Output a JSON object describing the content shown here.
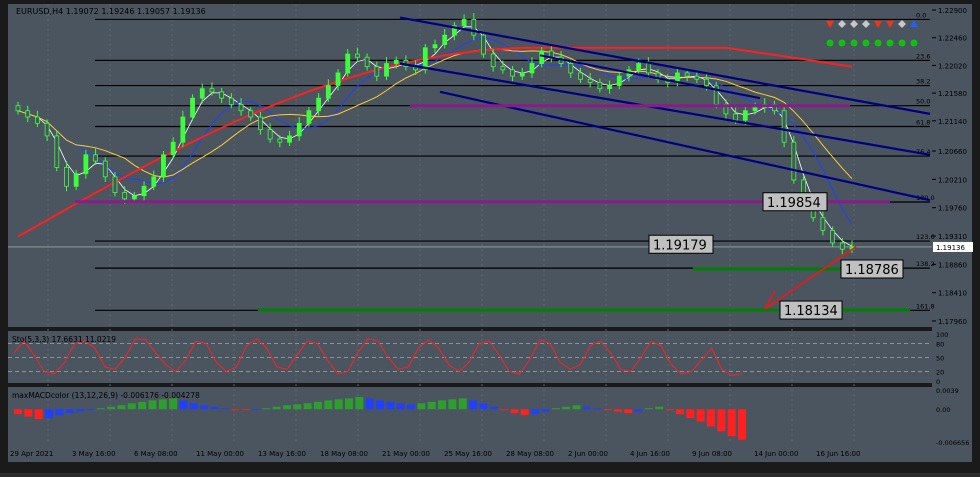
{
  "chart_data": {
    "type": "candlestick",
    "symbol_header": "EURUSD,H4  1.19072 1.19246 1.19057 1.19136",
    "colors": {
      "background": "#4a5560",
      "bull": "#3cff3c",
      "bear": "#3cff3c",
      "fib_lines": "#000000",
      "channel": "#000080",
      "sma_fast": "#ffffff",
      "sma_mid": "#2040ff",
      "sma_slow": "#ffcc33",
      "sma_long": "#ff2020",
      "support_purple": "#8b1a8b",
      "target_green": "#008000",
      "macd_pos": "#2e9e2e",
      "macd_neg": "#ff2020",
      "macd_blue": "#2040ff",
      "stoch": "#ff2020"
    },
    "price_axis": {
      "range": [
        1.1796,
        1.229
      ],
      "ticks": [
        "1.22900",
        "1.22460",
        "1.22020",
        "1.21580",
        "1.21140",
        "1.20660",
        "1.20210",
        "1.19760",
        "1.19310",
        "1.18860",
        "1.18410",
        "1.17960"
      ],
      "tick_values": [
        1.229,
        1.2246,
        1.2202,
        1.2158,
        1.2114,
        1.2066,
        1.2021,
        1.1976,
        1.1931,
        1.1886,
        1.1841,
        1.1796
      ],
      "current_price": "1.19136",
      "current_value": 1.19136
    },
    "time_axis": {
      "labels": [
        "29 Apr 2021",
        "3 May 16:00",
        "6 May 08:00",
        "11 May 00:00",
        "13 May 16:00",
        "18 May 08:00",
        "21 May 00:00",
        "25 May 16:00",
        "28 May 08:00",
        "2 Jun 00:00",
        "4 Jun 16:00",
        "9 Jun 08:00",
        "14 Jun 00:00",
        "16 Jun 16:00"
      ]
    },
    "fib_levels": [
      {
        "label": "0.0",
        "price": 1.2275
      },
      {
        "label": "23.6",
        "price": 1.221
      },
      {
        "label": "38.2",
        "price": 1.217
      },
      {
        "label": "50.0",
        "price": 1.2138
      },
      {
        "label": "61.8",
        "price": 1.2105
      },
      {
        "label": "76.4",
        "price": 1.2058
      },
      {
        "label": "100.0",
        "price": 1.1985
      },
      {
        "label": "123.6",
        "price": 1.1923
      },
      {
        "label": "138.2",
        "price": 1.188
      },
      {
        "label": "161.8",
        "price": 1.1813
      }
    ],
    "annotations": [
      {
        "text": "1.19854",
        "price": 1.19854
      },
      {
        "text": "1.19179",
        "price": 1.19179
      },
      {
        "text": "1.18786",
        "price": 1.18786
      },
      {
        "text": "1.18134",
        "price": 1.18134
      }
    ],
    "signal_row_1": [
      "down",
      "diamond",
      "diamond",
      "diamond",
      "down",
      "down",
      "diamond",
      "up"
    ],
    "signal_row_2": [
      "dot",
      "dot",
      "dot",
      "dot",
      "dot",
      "dot",
      "dot",
      "dot"
    ],
    "close_series": [
      1.213,
      1.212,
      1.211,
      1.209,
      1.204,
      1.201,
      1.203,
      1.206,
      1.205,
      1.2025,
      1.2,
      1.199,
      1.1995,
      1.201,
      1.2025,
      1.206,
      1.208,
      1.212,
      1.215,
      1.2165,
      1.216,
      1.215,
      1.214,
      1.213,
      1.212,
      1.21,
      1.2085,
      1.208,
      1.209,
      1.211,
      1.213,
      1.215,
      1.217,
      1.219,
      1.222,
      1.2215,
      1.22,
      1.2185,
      1.2205,
      1.221,
      1.22,
      1.2195,
      1.223,
      1.2235,
      1.225,
      1.2265,
      1.2275,
      1.225,
      1.222,
      1.22,
      1.2195,
      1.2185,
      1.219,
      1.2205,
      1.2225,
      1.2215,
      1.2205,
      1.219,
      1.218,
      1.2175,
      1.2165,
      1.217,
      1.2185,
      1.2195,
      1.2205,
      1.219,
      1.218,
      1.2175,
      1.219,
      1.2185,
      1.218,
      1.217,
      1.214,
      1.2125,
      1.2115,
      1.213,
      1.2135,
      1.214,
      1.213,
      1.208,
      1.202,
      1.1985,
      1.196,
      1.194,
      1.192,
      1.191,
      1.1914
    ],
    "stochastic": {
      "label": "Sto(5,3,3) 17.6631 11.0219",
      "ticks": [
        "100",
        "80",
        "50",
        "20",
        "0"
      ],
      "tick_values": [
        100,
        80,
        50,
        20,
        0
      ],
      "values": [
        60,
        85,
        55,
        20,
        15,
        40,
        80,
        85,
        70,
        30,
        25,
        50,
        90,
        88,
        60,
        35,
        20,
        45,
        85,
        80,
        40,
        20,
        30,
        75,
        90,
        70,
        30,
        25,
        55,
        85,
        80,
        45,
        15,
        20,
        60,
        90,
        85,
        50,
        25,
        30,
        70,
        88,
        70,
        35,
        20,
        40,
        80,
        85,
        55,
        20,
        15,
        45,
        88,
        80,
        40,
        25,
        35,
        75,
        85,
        60,
        25,
        20,
        50,
        85,
        75,
        35,
        15,
        20,
        45,
        70,
        25,
        12,
        15
      ]
    },
    "macd": {
      "label": "maxMACDcolor (13,12,26,9) -0.006176 -0.004278",
      "ticks": [
        "0.0039",
        "0.00",
        "-0.006656"
      ],
      "tick_values": [
        0.0039,
        0.0,
        -0.006656
      ],
      "values": [
        -0.001,
        -0.0015,
        -0.002,
        -0.0018,
        -0.0012,
        -0.0008,
        -0.0005,
        -0.0002,
        0.0002,
        0.0005,
        0.0008,
        0.0012,
        0.0015,
        0.0018,
        0.002,
        0.0022,
        0.0018,
        0.0012,
        0.0008,
        0.0005,
        0.0002,
        -0.0001,
        -0.0002,
        -0.0001,
        0.0002,
        0.0005,
        0.0008,
        0.001,
        0.0012,
        0.0015,
        0.0018,
        0.002,
        0.0022,
        0.0025,
        0.0022,
        0.0018,
        0.0015,
        0.0012,
        0.001,
        0.0012,
        0.0015,
        0.0018,
        0.002,
        0.0022,
        0.0018,
        0.0012,
        0.0005,
        -0.0002,
        -0.0008,
        -0.0012,
        -0.001,
        -0.0005,
        0.0002,
        0.0005,
        0.0008,
        0.0005,
        0.0002,
        -0.0002,
        -0.0005,
        -0.0008,
        -0.0005,
        0.0002,
        0.0005,
        -0.0002,
        -0.001,
        -0.0018,
        -0.0025,
        -0.0035,
        -0.0045,
        -0.0055,
        -0.0062
      ]
    }
  }
}
